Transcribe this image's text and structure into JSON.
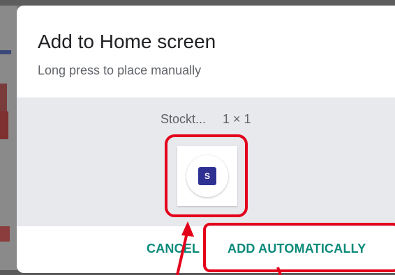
{
  "dialog": {
    "title": "Add to Home screen",
    "subtitle": "Long press to place manually",
    "widget_name": "Stockt...",
    "widget_size": "1 × 1",
    "widget_logo_letter": "S",
    "cancel_label": "CANCEL",
    "add_label": "ADD AUTOMATICALLY"
  },
  "colors": {
    "accent": "#0a8a7a",
    "annotation": "#e3001b",
    "logo_bg": "#2e3192"
  },
  "icons": {
    "widget": "stocktwits-widget-icon",
    "annotation_arrow": "arrow-icon"
  }
}
